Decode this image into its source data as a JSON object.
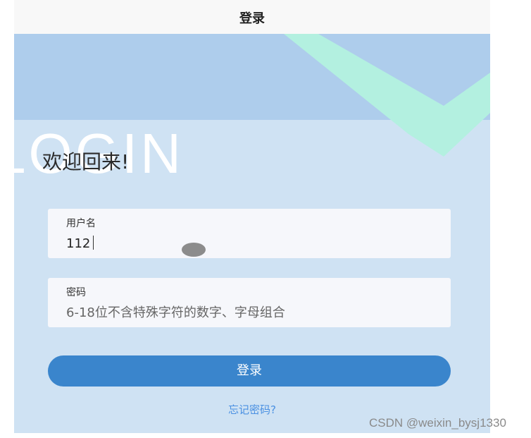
{
  "header": {
    "title": "登录"
  },
  "hero": {
    "background_text": "LOGIN",
    "welcome": "欢迎回来!"
  },
  "form": {
    "username": {
      "label": "用户名",
      "value": "112"
    },
    "password": {
      "label": "密码",
      "placeholder": "6-18位不含特殊字符的数字、字母组合"
    },
    "submit_label": "登录",
    "forgot_label": "忘记密码?"
  },
  "watermark": "CSDN @weixin_bysj1330",
  "colors": {
    "banner": "#aecdec",
    "background": "#cfe2f3",
    "chevron": "#b3f0e0",
    "primary_button": "#3a85cc",
    "link": "#4a90e2"
  }
}
